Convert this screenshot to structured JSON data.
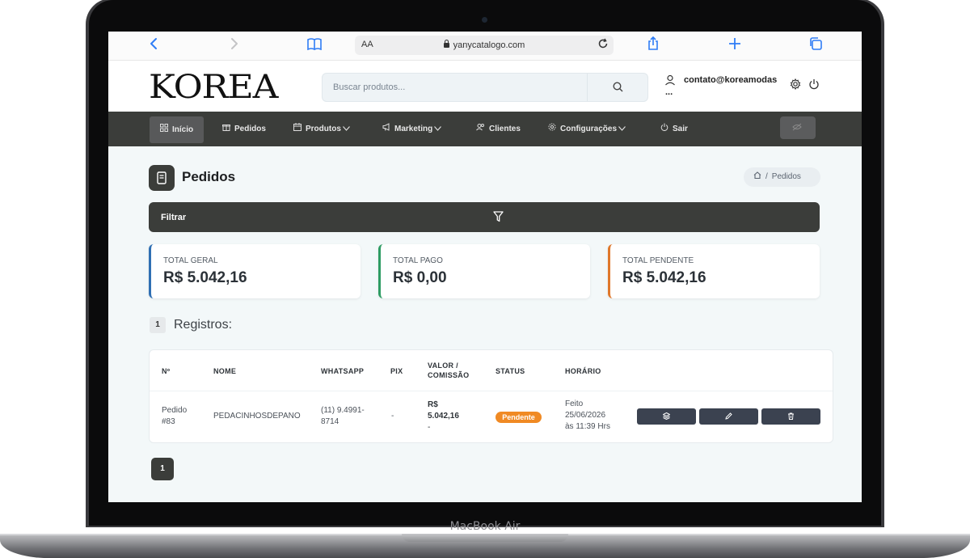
{
  "device": {
    "model_label": "MacBook Air"
  },
  "browser": {
    "url_text": "yanycatalogo.com",
    "aa_label": "AA",
    "icons": [
      "back-icon",
      "forward-icon",
      "bookmarks-icon",
      "share-icon",
      "new-tab-icon",
      "tabs-icon",
      "reload-icon",
      "lock-icon"
    ]
  },
  "header": {
    "logo_text": "KOREA",
    "search_placeholder": "Buscar produtos...",
    "user_email": "contato@koreamodas",
    "user_more": "..."
  },
  "nav": {
    "items": [
      {
        "label": "Início",
        "icon": "grid-icon",
        "active": true
      },
      {
        "label": "Pedidos",
        "icon": "gift-icon",
        "active": false
      },
      {
        "label": "Produtos",
        "icon": "calendar-icon",
        "active": false,
        "dropdown": true
      },
      {
        "label": "Marketing",
        "icon": "megaphone-icon",
        "active": false,
        "dropdown": true
      },
      {
        "label": "Clientes",
        "icon": "users-icon",
        "active": false
      },
      {
        "label": "Configurações",
        "icon": "gear-icon",
        "active": false,
        "dropdown": true
      },
      {
        "label": "Sair",
        "icon": "power-icon",
        "active": false
      }
    ]
  },
  "page": {
    "title": "Pedidos",
    "breadcrumb_current": "Pedidos",
    "breadcrumb_sep": "/",
    "filter_label": "Filtrar"
  },
  "cards": [
    {
      "label": "TOTAL GERAL",
      "value": "R$ 5.042,16",
      "color": "#2f6fb3"
    },
    {
      "label": "TOTAL PAGO",
      "value": "R$ 0,00",
      "color": "#2e9c63"
    },
    {
      "label": "TOTAL PENDENTE",
      "value": "R$ 5.042,16",
      "color": "#e0782b"
    }
  ],
  "records": {
    "count": "1",
    "label": "Registros:"
  },
  "table": {
    "headers": {
      "num": "Nº",
      "name": "NOME",
      "whatsapp": "WHATSAPP",
      "pix": "PIX",
      "valor_1": "VALOR /",
      "valor_2": "COMISSÃO",
      "status": "STATUS",
      "horario": "HORÁRIO"
    },
    "rows": [
      {
        "num_1": "Pedido",
        "num_2": "#83",
        "name": "PEDACINHOSDEPANO",
        "whatsapp_1": "(11) 9.4991-",
        "whatsapp_2": "8714",
        "pix": "-",
        "valor_1": "R$",
        "valor_2": "5.042,16",
        "valor_3": "-",
        "status": "Pendente",
        "horario_1": "Feito",
        "horario_2": "25/06/2026",
        "horario_3": "às 11:39 Hrs"
      }
    ]
  },
  "pagination": {
    "current": "1"
  }
}
